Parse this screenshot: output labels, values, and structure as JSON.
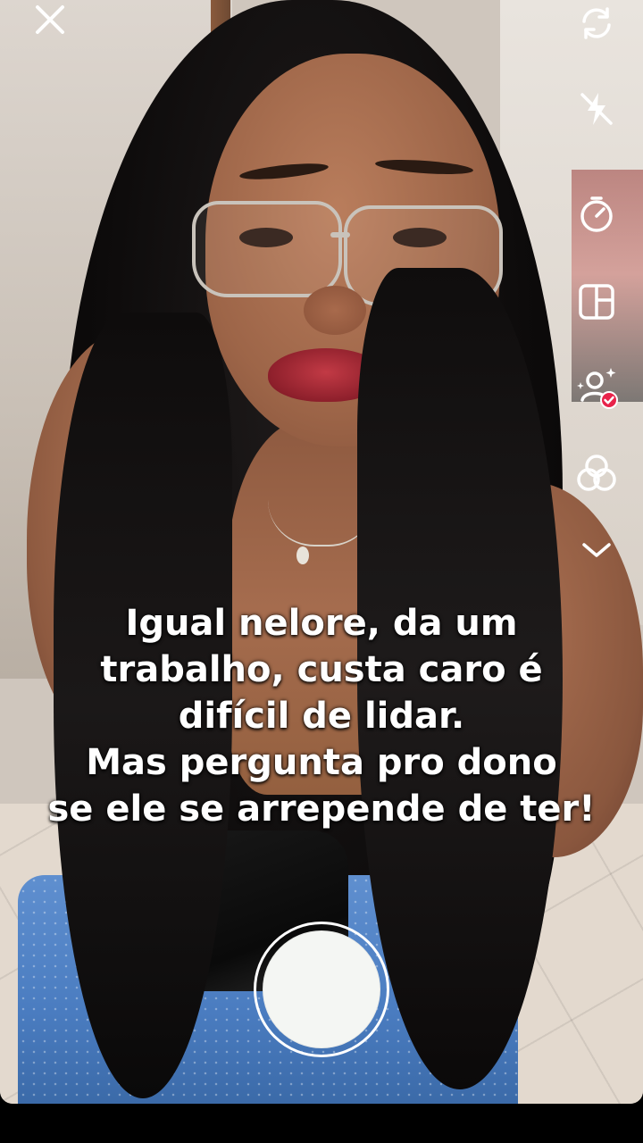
{
  "caption": {
    "lines": [
      "Igual nelore, da um",
      "trabalho, custa caro é",
      "difícil de lidar.",
      "Mas pergunta pro dono",
      "se ele se arrepende de ter!"
    ]
  },
  "toolbar": {
    "close_icon": "close-icon",
    "right_icons": [
      "flip-camera-icon",
      "flash-off-icon",
      "timer-icon",
      "layout-icon",
      "ai-effect-icon",
      "beauty-filter-icon",
      "chevron-down-icon"
    ],
    "ai_badge_color": "#e8234a"
  },
  "shutter": {
    "color": "#f4f6f3"
  }
}
